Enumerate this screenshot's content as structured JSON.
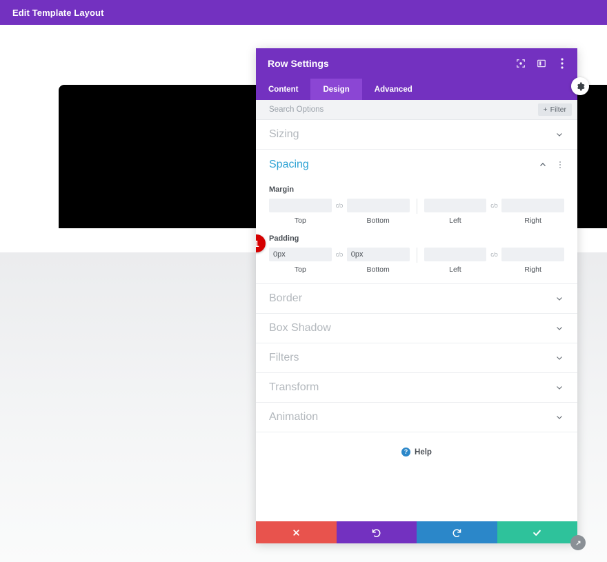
{
  "admin_bar": {
    "title": "Edit Template Layout",
    "background": "#7331c0"
  },
  "canvas": {
    "hero_block_color": "#000000",
    "page_background": "#f4f5f6"
  },
  "edge_toggle": {
    "icon": "settings-gear-icon"
  },
  "modal": {
    "title": "Row Settings",
    "header_background": "#7331c0",
    "header_icons": [
      {
        "name": "responsive-preview-icon"
      },
      {
        "name": "panel-layout-icon"
      },
      {
        "name": "more-options-icon"
      }
    ],
    "tabs": [
      {
        "label": "Content",
        "active": false
      },
      {
        "label": "Design",
        "active": true
      },
      {
        "label": "Advanced",
        "active": false
      }
    ],
    "search": {
      "placeholder": "Search Options",
      "value": ""
    },
    "filter_button": {
      "label": "Filter",
      "plus": "+"
    },
    "sections": [
      {
        "label": "Sizing",
        "state": "collapsed"
      },
      {
        "label": "Spacing",
        "state": "expanded"
      },
      {
        "label": "Border",
        "state": "collapsed"
      },
      {
        "label": "Box Shadow",
        "state": "collapsed"
      },
      {
        "label": "Filters",
        "state": "collapsed"
      },
      {
        "label": "Transform",
        "state": "collapsed"
      },
      {
        "label": "Animation",
        "state": "collapsed"
      }
    ],
    "spacing": {
      "margin": {
        "label": "Margin",
        "fields": [
          {
            "label": "Top",
            "value": "",
            "placeholder": ""
          },
          {
            "label": "Bottom",
            "value": "",
            "placeholder": ""
          },
          {
            "label": "Left",
            "value": "",
            "placeholder": ""
          },
          {
            "label": "Right",
            "value": "",
            "placeholder": ""
          }
        ]
      },
      "padding": {
        "label": "Padding",
        "fields": [
          {
            "label": "Top",
            "value": "0px",
            "placeholder": ""
          },
          {
            "label": "Bottom",
            "value": "0px",
            "placeholder": ""
          },
          {
            "label": "Left",
            "value": "",
            "placeholder": ""
          },
          {
            "label": "Right",
            "value": "",
            "placeholder": ""
          }
        ]
      },
      "link_glyph": "c/ɔ"
    },
    "marker_badge": {
      "number": "1",
      "color": "#d50000"
    },
    "help": {
      "label": "Help",
      "icon_char": "?"
    },
    "footer": {
      "buttons": [
        {
          "name": "cancel",
          "icon": "close-icon",
          "color": "#e8534d"
        },
        {
          "name": "undo",
          "icon": "undo-icon",
          "color": "#7331c0"
        },
        {
          "name": "redo",
          "icon": "redo-icon",
          "color": "#2b87c9"
        },
        {
          "name": "save",
          "icon": "checkmark-icon",
          "color": "#2ec29b"
        }
      ]
    }
  }
}
